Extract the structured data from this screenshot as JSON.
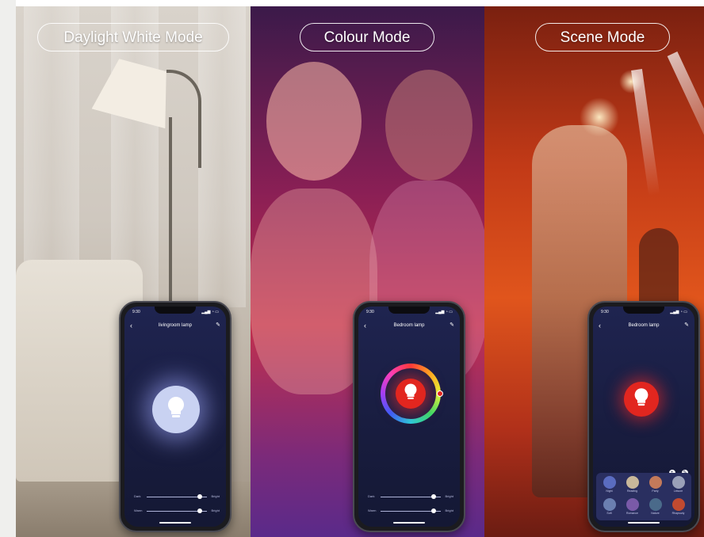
{
  "modes": [
    {
      "label": "Daylight White Mode"
    },
    {
      "label": "Colour Mode"
    },
    {
      "label": "Scene Mode"
    }
  ],
  "phones": [
    {
      "time": "9:30",
      "status": "▂▄▆ ◔ ▭",
      "title": "livingroom lamp",
      "bulb_color": "#c9d2f2",
      "sliders": [
        {
          "label": "Dark",
          "end": "Bright",
          "value": 0.88
        },
        {
          "label": "Warm",
          "end": "Bright",
          "value": 0.88
        }
      ]
    },
    {
      "time": "9:30",
      "status": "▂▄▆ ◔ ▭",
      "title": "Bedroom lamp",
      "bulb_color": "#e2261f",
      "sliders": [
        {
          "label": "Dark",
          "end": "Bright",
          "value": 0.88
        },
        {
          "label": "Warm",
          "end": "Bright",
          "value": 0.88
        }
      ]
    },
    {
      "time": "9:30",
      "status": "▂▄▆ ◔ ▭",
      "title": "Bedroom lamp",
      "bulb_color": "#e2261f",
      "scenes": [
        {
          "name": "Night",
          "color": "#5a6cc0"
        },
        {
          "name": "Reading",
          "color": "#c9b89a"
        },
        {
          "name": "Party",
          "color": "#c47a5a"
        },
        {
          "name": "Leisure",
          "color": "#9aa0b8"
        },
        {
          "name": "Soft",
          "color": "#6b7fb0"
        },
        {
          "name": "Romance",
          "color": "#7a5aa8"
        },
        {
          "name": "Nature",
          "color": "#4a6a8a"
        },
        {
          "name": "Rhapsody",
          "color": "#c04a30"
        }
      ]
    }
  ],
  "icons": {
    "back": "‹",
    "edit": "✎",
    "bulb": "💡"
  },
  "colors": {
    "screen_bg": "#1b1f45",
    "accent_red": "#e2261f",
    "daylight_glow": "#c9d2f2"
  }
}
